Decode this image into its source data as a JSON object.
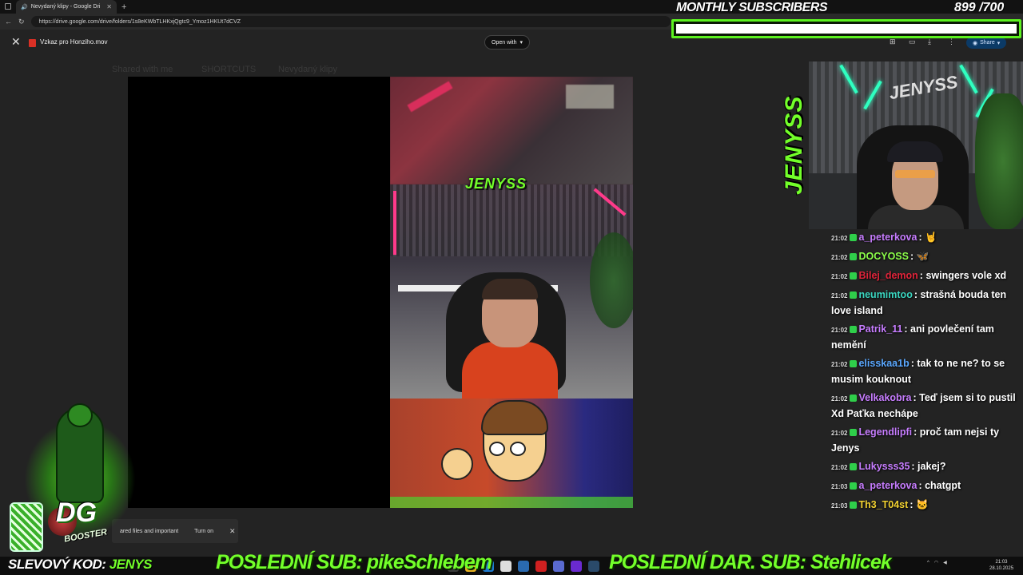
{
  "browser": {
    "tab_title": "Nevydaný klipy - Google Dri",
    "url": "https://drive.google.com/drive/folders/1s8eKWbTLHKxjQgtc9_Ymoz1HKUt7dCVZ"
  },
  "drive": {
    "file_name": "Vzkaz pro Honziho.mov",
    "open_with": "Open with",
    "share": "Share",
    "breadcrumb": [
      "Shared with me",
      "SHORTCUTS",
      "Nevydaný klipy"
    ],
    "notice_text": "ared files and important",
    "notice_action": "Turn on"
  },
  "overlay": {
    "subs_title": "MONTHLY SUBSCRIBERS",
    "subs_count": "899 /700",
    "subs_progress": 1.0,
    "side_logo": "JENYSS",
    "video_logo": "JENYSS",
    "promo_prefix": "SLEVOVÝ KOD:",
    "promo_code": "JENYS",
    "last_sub": "POSLEDNÍ SUB: pikeSchlebem",
    "last_gift": "POSLEDNÍ DAR. SUB: Stehlicek",
    "mascot_brand": "DG",
    "mascot_sub": "BOOSTER",
    "accent": "#73ff2a"
  },
  "chat": [
    {
      "time": "21:02",
      "user": "a_peterkova",
      "color": "#c77dff",
      "text": "🤘"
    },
    {
      "time": "21:02",
      "user": "DOCYOSS",
      "color": "#8cff4a",
      "text": "🦋"
    },
    {
      "time": "21:02",
      "user": "Bilej_demon",
      "color": "#e0243a",
      "text": "swingers vole xd"
    },
    {
      "time": "21:02",
      "user": "neumimtoo",
      "color": "#3ad6c0",
      "text": "strašná bouda ten love island"
    },
    {
      "time": "21:02",
      "user": "Patrik_11",
      "color": "#c77dff",
      "text": "ani povlečení tam nemění"
    },
    {
      "time": "21:02",
      "user": "elisskaa1b",
      "color": "#5aa8ff",
      "text": "tak to ne ne? to se musim kouknout"
    },
    {
      "time": "21:02",
      "user": "Velkakobra",
      "color": "#c77dff",
      "text": "Teď jsem si to pustil Xd Paťka nechápe"
    },
    {
      "time": "21:02",
      "user": "Legendlipfi",
      "color": "#c77dff",
      "text": "proč tam nejsi ty Jenys"
    },
    {
      "time": "21:02",
      "user": "Lukysss35",
      "color": "#c77dff",
      "text": "jakej?"
    },
    {
      "time": "21:03",
      "user": "a_peterkova",
      "color": "#c77dff",
      "text": "chatgpt"
    },
    {
      "time": "21:03",
      "user": "Th3_T04st",
      "color": "#f0d030",
      "text": "🐱"
    }
  ],
  "taskbar": {
    "time": "21:03",
    "date": "28.10.2025"
  }
}
